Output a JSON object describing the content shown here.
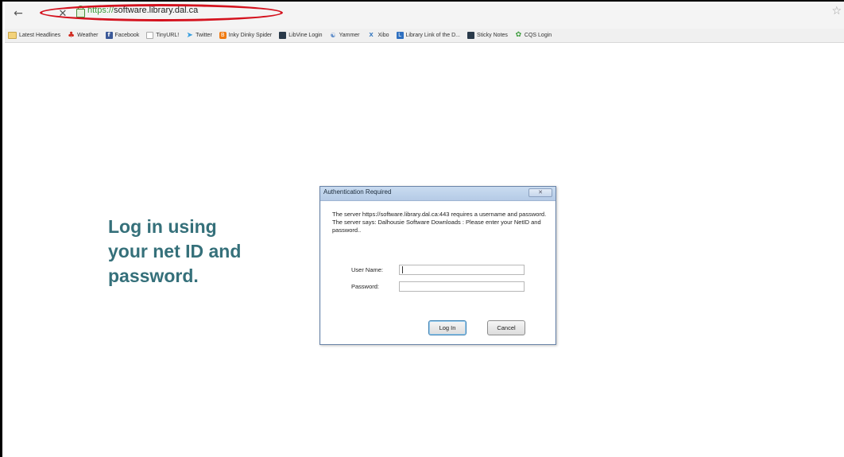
{
  "browser": {
    "url_scheme": "https://",
    "url_host": "software.library.dal.ca",
    "highlight_color": "#d4121e"
  },
  "bookmarks": [
    {
      "label": "Latest Headlines",
      "icon": "folder-icon"
    },
    {
      "label": "Weather",
      "icon": "maple-leaf-icon"
    },
    {
      "label": "Facebook",
      "icon": "facebook-icon"
    },
    {
      "label": "TinyURL!",
      "icon": "page-icon"
    },
    {
      "label": "Twitter",
      "icon": "twitter-bird-icon"
    },
    {
      "label": "Inky Dinky Spider",
      "icon": "blogger-icon"
    },
    {
      "label": "LibVine Login",
      "icon": "square-icon"
    },
    {
      "label": "Yammer",
      "icon": "yammer-icon"
    },
    {
      "label": "Xibo",
      "icon": "xibo-icon"
    },
    {
      "label": "Library Link of the D...",
      "icon": "library-icon"
    },
    {
      "label": "Sticky Notes",
      "icon": "square-icon"
    },
    {
      "label": "CQS Login",
      "icon": "cq-icon"
    }
  ],
  "main": {
    "instruction": "Log in using\nyour net ID and\npassword.",
    "instruction_color": "#35707a"
  },
  "dialog": {
    "title": "Authentication Required",
    "message": "The server https://software.library.dal.ca:443 requires a username and password. The server says: Dalhousie Software Downloads : Please enter your NetID and password..",
    "username_label": "User Name:",
    "username_value": "",
    "password_label": "Password:",
    "password_value": "",
    "login_button": "Log In",
    "cancel_button": "Cancel"
  }
}
